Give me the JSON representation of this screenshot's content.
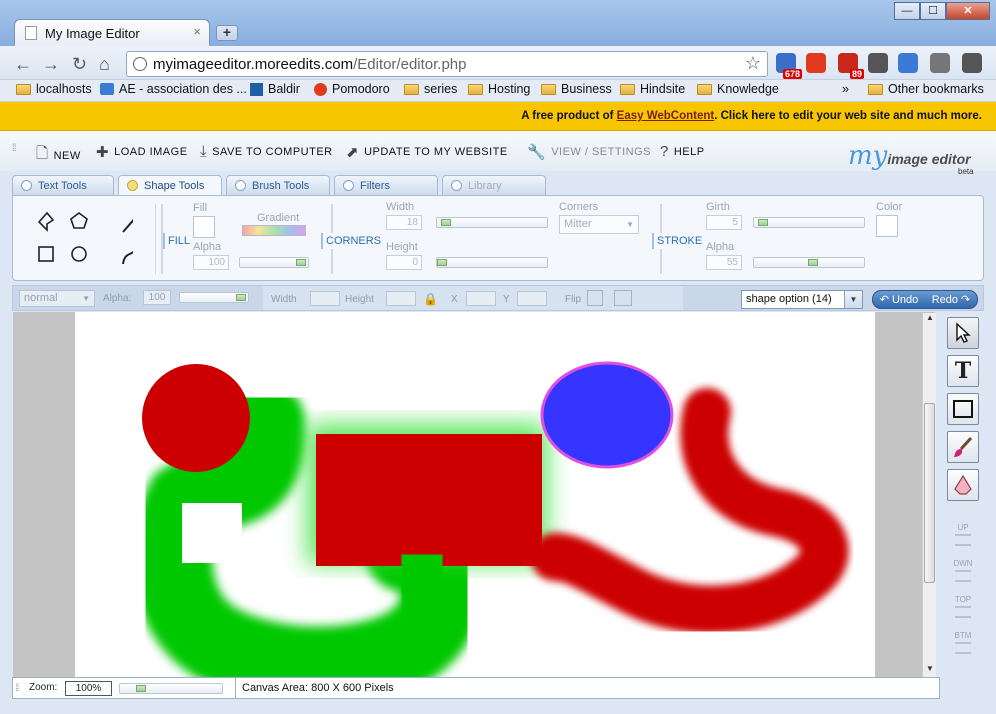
{
  "browser": {
    "tab_title": "My Image Editor",
    "tab_close": "×",
    "new_tab": "+",
    "window_buttons": {
      "minimize": "—",
      "maximize": "☐",
      "close": "✕"
    },
    "url_domain": "myimageeditor.moreedits.com",
    "url_path": "/Editor/editor.php",
    "extensions": [
      {
        "name": "rss-icon",
        "badge": "678",
        "color": "#3b6ec8"
      },
      {
        "name": "tomato-icon",
        "badge": "",
        "color": "#e23a1e"
      },
      {
        "name": "gmail-icon",
        "badge": "89",
        "color": "#c9281c"
      },
      {
        "name": "gear-icon",
        "badge": "",
        "color": "#555555"
      },
      {
        "name": "window-icon",
        "badge": "",
        "color": "#3a7bd5"
      },
      {
        "name": "printer-icon",
        "badge": "",
        "color": "#777777"
      },
      {
        "name": "wrench-icon",
        "badge": "",
        "color": "#555555"
      }
    ],
    "bookmarks": [
      {
        "label": "localhosts",
        "icon": "folder"
      },
      {
        "label": "AE - association des ...",
        "icon": "ae"
      },
      {
        "label": "Baldir",
        "icon": "z"
      },
      {
        "label": "Pomodoro",
        "icon": "tomato"
      },
      {
        "label": "series",
        "icon": "folder"
      },
      {
        "label": "Hosting",
        "icon": "folder"
      },
      {
        "label": "Business",
        "icon": "folder"
      },
      {
        "label": "Hindsite",
        "icon": "folder"
      },
      {
        "label": "Knowledge",
        "icon": "folder"
      }
    ],
    "bookmarks_overflow": "»",
    "other_bookmarks": "Other bookmarks"
  },
  "promo": {
    "prefix": "A free product of ",
    "link": "Easy WebContent",
    "middle": ". Click ",
    "link2": "here",
    "suffix": " to edit your web site and much more."
  },
  "menu": {
    "items": [
      {
        "label": "NEW",
        "icon": "new-file-icon",
        "glyph": "🗋"
      },
      {
        "label": "LOAD IMAGE",
        "icon": "plus-icon",
        "glyph": "✚"
      },
      {
        "label": "SAVE TO COMPUTER",
        "icon": "download-icon",
        "glyph": "⤓"
      },
      {
        "label": "UPDATE TO MY WEBSITE",
        "icon": "upload-icon",
        "glyph": "⬈"
      },
      {
        "label": "VIEW / SETTINGS",
        "icon": "wrench-icon",
        "glyph": "🔧"
      },
      {
        "label": "HELP",
        "icon": "question-icon",
        "glyph": "?"
      }
    ],
    "logo_my": "my",
    "logo_text": "image editor",
    "logo_beta": "beta"
  },
  "tabs": [
    "Text Tools",
    "Shape Tools",
    "Brush Tools",
    "Filters",
    "Library"
  ],
  "active_tab": "Shape Tools",
  "shape_panel": {
    "fill_label": "Fill",
    "gradient_label": "Gradient",
    "alpha_label": "Alpha",
    "alpha_value": "100",
    "fill_btn": "FILL",
    "width_label": "Width",
    "width_value": "18",
    "height_label": "Height",
    "height_value": "0",
    "corners_btn": "CORNERS",
    "corners_label": "Corners",
    "corners_value": "Mitter",
    "stroke_btn": "STROKE",
    "girth_label": "Girth",
    "girth_value": "5",
    "alpha2_label": "Alpha",
    "alpha2_value": "55",
    "color_label": "Color"
  },
  "props_bar": {
    "blend": "normal",
    "alpha_label": "Alpha:",
    "alpha_value": "100",
    "width_label": "Width",
    "height_label": "Height",
    "x_label": "X",
    "y_label": "Y",
    "flip_label": "Flip",
    "shape_option": "shape option  (14)",
    "undo": "Undo",
    "redo": "Redo"
  },
  "side_tools": [
    {
      "name": "select-arrow-icon"
    },
    {
      "name": "text-tool-icon",
      "glyph": "T"
    },
    {
      "name": "rectangle-tool-icon"
    },
    {
      "name": "brush-tool-icon"
    },
    {
      "name": "eraser-tool-icon"
    }
  ],
  "layer_buttons": [
    "UP",
    "DWN",
    "TOP",
    "BTM"
  ],
  "footer": {
    "zoom_label": "Zoom:",
    "zoom_value": "100%",
    "canvas_area": "Canvas Area: 800 X 600 Pixels"
  },
  "colors": {
    "red": "#cc0000",
    "green": "#00c800",
    "blue": "#3535ff",
    "magenta": "#e04fe0",
    "promo": "#f7c600"
  }
}
